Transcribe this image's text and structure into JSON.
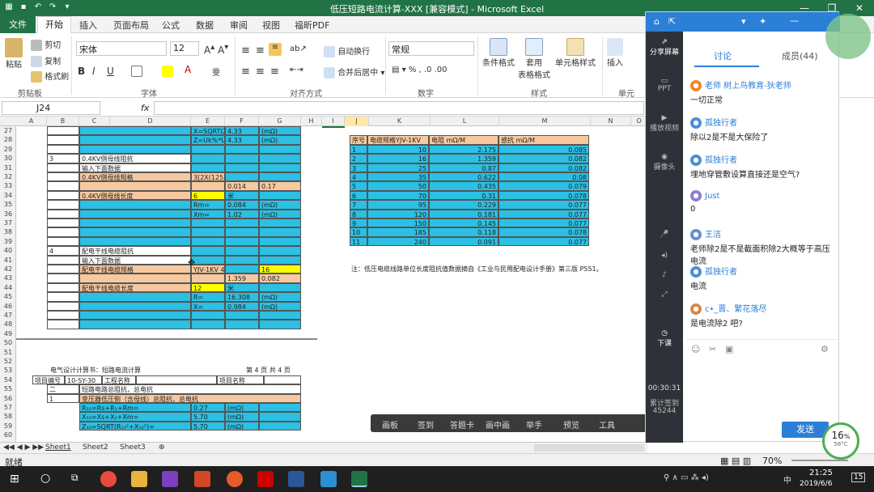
{
  "window": {
    "title": "低压短路电流计算-XXX  [兼容模式] - Microsoft Excel",
    "minimize": "—",
    "restore": "❐",
    "close": "✕"
  },
  "tabs": [
    "文件",
    "开始",
    "插入",
    "页面布局",
    "公式",
    "数据",
    "审阅",
    "视图",
    "福昕PDF"
  ],
  "ribbon": {
    "paste": "粘贴",
    "cut": "剪切",
    "copy": "复制",
    "format_painter": "格式刷",
    "clipboard": "剪贴板",
    "font_name": "宋体",
    "font_size": "12",
    "font_group": "字体",
    "wrap": "自动换行",
    "merge": "合并后居中",
    "align_group": "对齐方式",
    "number_format": "常规",
    "number_group": "数字",
    "cond_format": "条件格式",
    "table_format": "套用\n表格格式",
    "cell_style": "单元格样式",
    "style_group": "样式",
    "insert": "插入",
    "cells_group": "单元"
  },
  "formula_bar": {
    "cell_ref": "J24",
    "fx": "fx"
  },
  "columns": [
    "A",
    "B",
    "C",
    "D",
    "E",
    "F",
    "G",
    "H",
    "I",
    "J",
    "K",
    "L",
    "M",
    "N",
    "O"
  ],
  "rows": [
    "27",
    "28",
    "29",
    "30",
    "31",
    "32",
    "33",
    "34",
    "35",
    "36",
    "37",
    "38",
    "39",
    "40",
    "41",
    "42",
    "43",
    "44",
    "45",
    "46",
    "47",
    "48",
    "49",
    "50",
    "51",
    "52",
    "53",
    "54",
    "55",
    "56",
    "57",
    "58",
    "59",
    "60"
  ],
  "left_block": [
    [
      "",
      "",
      "X=SQRT(Z²-R²)=",
      "4.33",
      "(mΩ)"
    ],
    [
      "",
      "",
      "Z=Uk%*Ur²/(100*Sr)=",
      "4.33",
      "(mΩ)"
    ],
    [
      "3",
      "0.4KV侧母线阻抗",
      "",
      "",
      ""
    ],
    [
      "",
      "输入下面数据",
      "",
      "",
      ""
    ],
    [
      "",
      "0.4KV侧母线规格",
      "3[2X(125X10)]+1X(125X10)",
      "",
      ""
    ],
    [
      "",
      "",
      "",
      "0.014",
      "0.17"
    ],
    [
      "",
      "0.4KV侧母线长度",
      "6",
      "米",
      ""
    ],
    [
      "",
      "",
      "Rm=",
      "0.084",
      "(mΩ)"
    ],
    [
      "",
      "",
      "Xm=",
      "1.02",
      "(mΩ)"
    ],
    [
      "4",
      "配电干线电缆阻抗",
      "",
      "",
      ""
    ],
    [
      "",
      "输入下面数据",
      "",
      "",
      ""
    ],
    [
      "",
      "配电干线电缆规格",
      "YJV-1KV 4X",
      "",
      "16"
    ],
    [
      "",
      "",
      "",
      "1.359",
      "0.082"
    ],
    [
      "",
      "配电干线电缆长度",
      "12",
      "米",
      ""
    ],
    [
      "",
      "",
      "R=",
      "16.308",
      "(mΩ)"
    ],
    [
      "",
      "",
      "X=",
      "0.984",
      "(mΩ)"
    ]
  ],
  "right_table": {
    "headers": [
      "序号",
      "电缆规格YJV-1KV",
      "电阻 mΩ/M",
      "感抗 mΩ/M"
    ],
    "rows": [
      [
        "1",
        "10",
        "2.175",
        "0.085"
      ],
      [
        "2",
        "16",
        "1.359",
        "0.082"
      ],
      [
        "3",
        "25",
        "0.87",
        "0.082"
      ],
      [
        "4",
        "35",
        "0.622",
        "0.08"
      ],
      [
        "5",
        "50",
        "0.435",
        "0.079"
      ],
      [
        "6",
        "70",
        "0.31",
        "0.078"
      ],
      [
        "7",
        "95",
        "0.229",
        "0.077"
      ],
      [
        "8",
        "120",
        "0.181",
        "0.077"
      ],
      [
        "9",
        "150",
        "0.145",
        "0.077"
      ],
      [
        "10",
        "185",
        "0.118",
        "0.078"
      ],
      [
        "11",
        "240",
        "0.091",
        "0.077"
      ]
    ],
    "note": "注：低压电缆线路单位长度阻抗值数据摘自《工业与民用配电设计手册》第三版 P551。"
  },
  "lower_block": {
    "title": "电气设计计算书：短路电流计算",
    "page": "第 4 页  共 4 页",
    "proj_no_label": "项目编号",
    "proj_no": "10-SY-30",
    "proj_name_label": "工程名称",
    "item_name_label": "项目名称",
    "sec": "二",
    "sec_text": "短路电路总阻抗，总电抗",
    "s1": "1",
    "s1_text": "变压器低压侧（含母线）总阻抗，总电抗",
    "r1": "R₁₀=Rs+R₁+Rm=",
    "v1": "0.27",
    "u1": "(mΩ)",
    "r2": "X₁₀=Xs+X₁+Xm=",
    "v2": "5.70",
    "u2": "(mΩ)",
    "r3": "Z₁₀=SQRT(R₁₀²+X₁₀²)=",
    "v3": "5.70",
    "u3": "(mΩ)"
  },
  "sheet_tabs": [
    "Sheet1",
    "Sheet2",
    "Sheet3"
  ],
  "status": {
    "ready": "就绪",
    "zoom": "70%"
  },
  "taskbar": {
    "time": "21:25",
    "date": "2019/6/6",
    "ime": "中",
    "notif": "15"
  },
  "panel": {
    "share_screen": "分享屏幕",
    "ppt": "PPT",
    "video": "播放视频",
    "camera": "摄像头",
    "tab_discuss": "讨论",
    "tab_score": "成员(44)",
    "download": "下课",
    "timer": "00:30:31",
    "cumulative_label": "累计签到",
    "cumulative": "45244",
    "send": "发送",
    "messages": [
      {
        "user": "老师 树上鸟教育-狄老师",
        "text": "一切正常",
        "color": "#f08a24"
      },
      {
        "user": "孤独行者",
        "text": "除以2是不是大保险了",
        "color": "#4a8fd6"
      },
      {
        "user": "孤独行者",
        "text": "埋地穿管敷设算直接还是空气?",
        "color": "#4a8fd6"
      },
      {
        "user": "Just",
        "text": "0",
        "color": "#8a7fd6"
      },
      {
        "user": "王洁",
        "text": "老师除2是不是截面积除2大概等于高压电流",
        "color": "#6a8fd6"
      },
      {
        "user": "孤独行者",
        "text": "电流",
        "color": "#4a8fd6"
      },
      {
        "user": "c•_晋、繁花落尽",
        "text": "是电流除2 吧?",
        "color": "#d68a4a"
      }
    ]
  },
  "float_toolbar": [
    "画板",
    "签到",
    "答题卡",
    "画中画",
    "举手",
    "预览",
    "工具"
  ],
  "gauge": {
    "value": "16",
    "unit": "%",
    "temp": "58°C"
  }
}
